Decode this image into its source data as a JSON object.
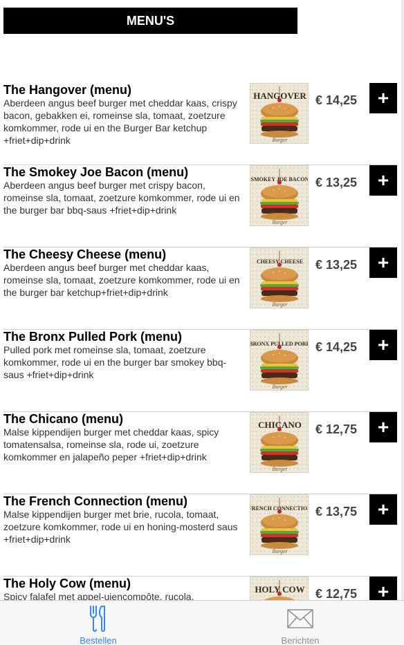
{
  "header": {
    "title": "MENU'S"
  },
  "menu": {
    "items": [
      {
        "title": "The Hangover (menu)",
        "description": "Aberdeen angus beef burger met cheddar kaas, crispy bacon, gebakken ei, romeinse sla, tomaat, zoetzure komkommer, rode ui en the Burger Bar ketchup +friet+dip+drink",
        "image_label": "HANGOVER",
        "price": "€ 14,25",
        "add_label": "+"
      },
      {
        "title": "The Smokey Joe Bacon (menu)",
        "description": "Aberdeen angus beef burger met crispy bacon, romeinse sla, tomaat, zoetzure komkommer, rode ui en the burger bar bbq-saus +friet+dip+drink",
        "image_label": "SMOKEY JOE BACON",
        "price": "€ 13,25",
        "add_label": "+"
      },
      {
        "title": "The Cheesy Cheese (menu)",
        "description": "Aberdeen angus beef burger met cheddar kaas, romeinse sla, tomaat, zoetzure komkommer, rode ui en the burger bar ketchup+friet+dip+drink",
        "image_label": "CHEESY CHEESE",
        "price": "€ 13,25",
        "add_label": "+"
      },
      {
        "title": "The Bronx Pulled Pork (menu)",
        "description": "Pulled pork met romeinse sla, tomaat, zoetzure komkommer, rode ui en the burger bar smokey bbq-saus +friet+dip+drink",
        "image_label": "BRONX PULLED PORK",
        "price": "€ 14,25",
        "add_label": "+"
      },
      {
        "title": "The Chicano (menu)",
        "description": "Malse kippendijen burger met cheddar kaas, spicy tomatensalsa, romeinse sla, rode ui, zoetzure komkommer en jalapeño peper +friet+dip+drink",
        "image_label": "CHICANO",
        "price": "€ 12,75",
        "add_label": "+"
      },
      {
        "title": "The French Connection (menu)",
        "description": "Malse kippendijen burger met brie, rucola, tomaat, zoetzure komkommer, rode ui en honing-mosterd saus +friet+dip+drink",
        "image_label": "FRENCH CONNECTION",
        "price": "€ 13,75",
        "add_label": "+"
      },
      {
        "title": "The Holy Cow (menu)",
        "description": "Spicy falafel met appel-uiencompôte, rucola,",
        "image_label": "HOLY COW",
        "price": "€ 12,75",
        "add_label": "+"
      }
    ]
  },
  "image_sublabel": "Burger",
  "tabbar": {
    "tabs": [
      {
        "label": "Bestellen",
        "icon": "fork-knife-icon",
        "active": true,
        "color": "#2f86f5"
      },
      {
        "label": "Berichten",
        "icon": "envelope-icon",
        "active": false,
        "color": "#8e8e93"
      }
    ]
  },
  "colors": {
    "accent": "#2f86f5",
    "header_bg": "#000000",
    "button_bg": "#000000"
  }
}
